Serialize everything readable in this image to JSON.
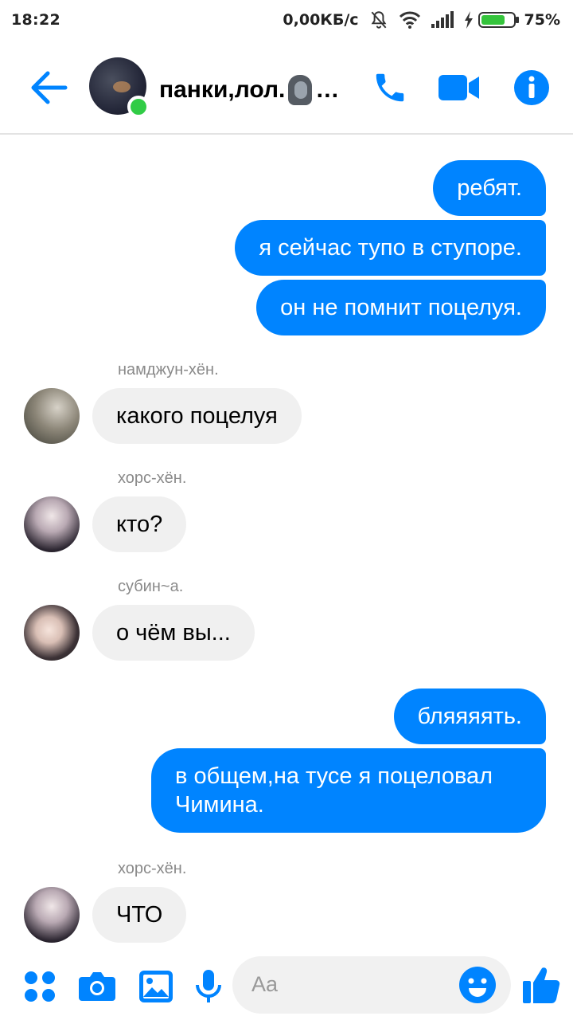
{
  "status_bar": {
    "time": "18:22",
    "network_speed": "0,00КБ/с",
    "battery_percent": "75%",
    "battery_level": 0.75,
    "icons": [
      "mute-icon",
      "wifi-icon",
      "signal-icon",
      "charging-icon",
      "battery-icon"
    ]
  },
  "header": {
    "title": "панки,лол.",
    "title_suffix": "…",
    "back_icon": "arrow-left-icon",
    "call_icon": "phone-icon",
    "video_icon": "video-camera-icon",
    "info_icon": "info-icon",
    "online": true
  },
  "messages": {
    "out1": "ребят.",
    "out2": "я сейчас тупо в ступоре.",
    "out3": "он не помнит поцелуя.",
    "sender1": "намджун-хён.",
    "in1": "какого поцелуя",
    "sender2": "хорс-хён.",
    "in2": "кто?",
    "sender3": "субин~а.",
    "in3": "о чём вы...",
    "out4": "бляяяять.",
    "out5": "в общем,на тусе я поцеловал Чимина.",
    "sender4": "хорс-хён.",
    "in4": "ЧТО"
  },
  "composer": {
    "placeholder": "Aa",
    "icons": [
      "apps-icon",
      "camera-icon",
      "gallery-icon",
      "microphone-icon",
      "emoji-icon",
      "thumbs-up-icon"
    ]
  },
  "colors": {
    "accent": "#0084ff",
    "incoming_bubble": "#f0f0f0",
    "online": "#31cc46"
  }
}
